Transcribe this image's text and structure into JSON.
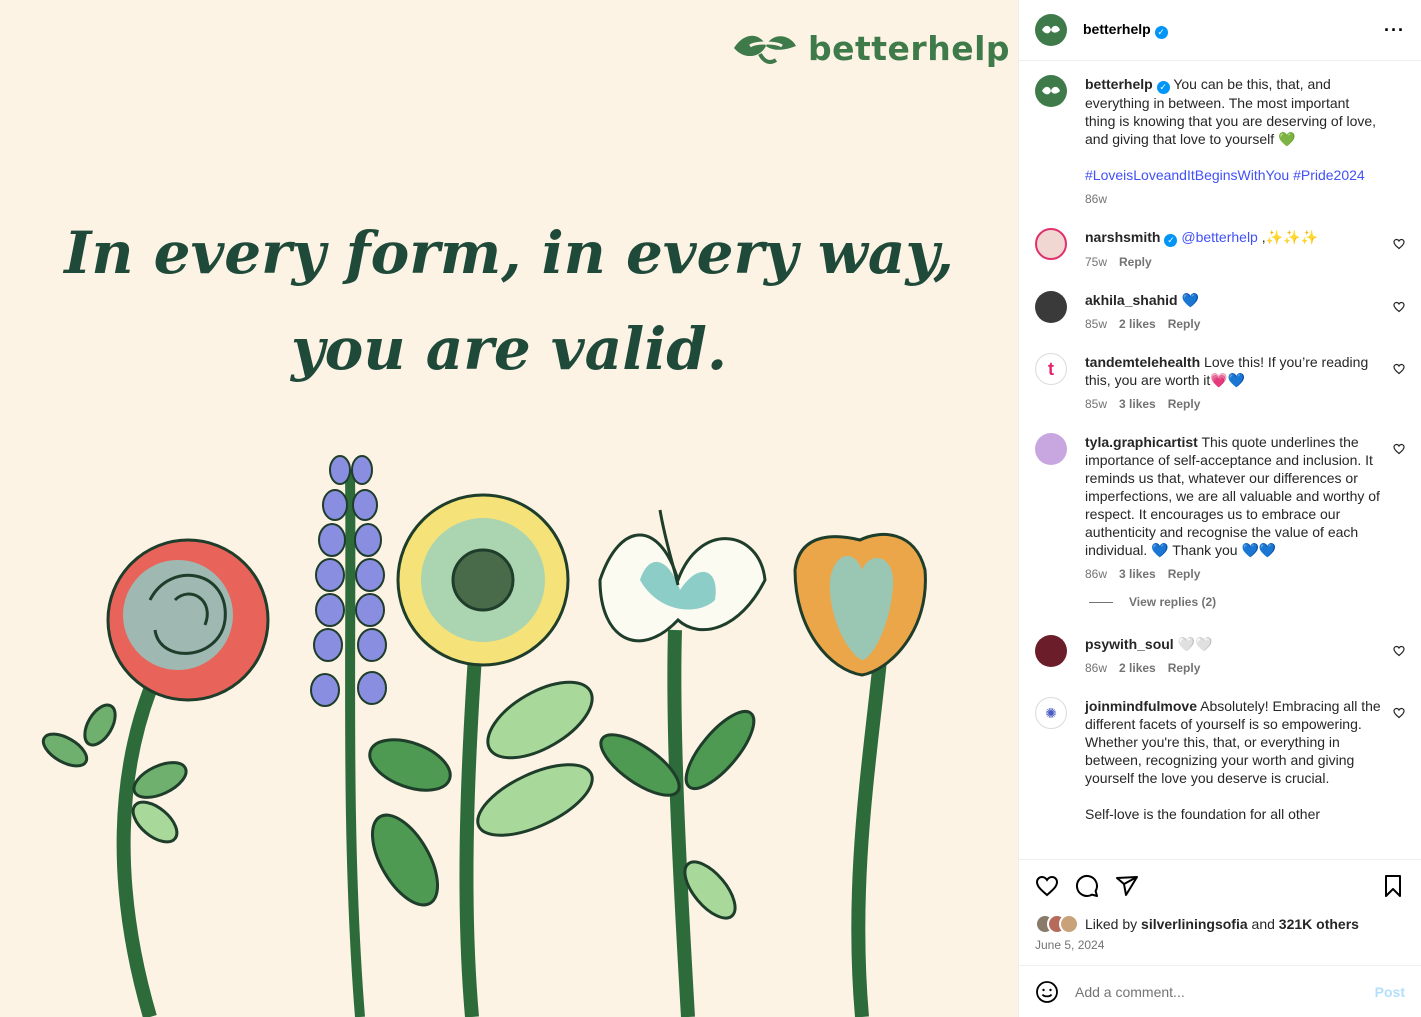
{
  "image": {
    "brand_name": "betterhelp",
    "quote_line1": "In every form, in every way,",
    "quote_line2": "you are valid."
  },
  "header": {
    "username": "betterhelp",
    "verified": true,
    "more_icon": "more-horizontal-icon"
  },
  "caption": {
    "username": "betterhelp",
    "text": "You can be this, that, and everything in between. The most important thing is knowing that you are deserving of love, and giving that love to yourself 💚",
    "hashtags": "#LoveisLoveandItBeginsWithYou #Pride2024",
    "time": "86w"
  },
  "comments": [
    {
      "username": "narshsmith",
      "verified": true,
      "mention": "@betterhelp",
      "text": " ,✨✨✨",
      "time": "75w",
      "likes": "",
      "reply": "Reply"
    },
    {
      "username": "akhila_shahid",
      "verified": false,
      "mention": "",
      "text": "💙",
      "time": "85w",
      "likes": "2 likes",
      "reply": "Reply"
    },
    {
      "username": "tandemtelehealth",
      "verified": false,
      "mention": "",
      "text": "Love this! If you’re reading this, you are worth it💗💙",
      "time": "85w",
      "likes": "3 likes",
      "reply": "Reply"
    },
    {
      "username": "tyla.graphicartist",
      "verified": false,
      "mention": "",
      "text": "This quote underlines the importance of self-acceptance and inclusion. It reminds us that, whatever our differences or imperfections, we are all valuable and worthy of respect. It encourages us to embrace our authenticity and recognise the value of each individual. 💙 Thank you 💙💙",
      "time": "86w",
      "likes": "3 likes",
      "reply": "Reply"
    },
    {
      "username": "psywith_soul",
      "verified": false,
      "mention": "",
      "text": "🤍🤍",
      "time": "86w",
      "likes": "2 likes",
      "reply": "Reply"
    },
    {
      "username": "joinmindfulmove",
      "verified": false,
      "mention": "",
      "text": "Absolutely! Embracing all the different facets of yourself is so empowering. Whether you're this, that, or everything in between, recognizing your worth and giving yourself the love you deserve is crucial.",
      "text2": "Self-love is the foundation for all other",
      "time": "",
      "likes": "",
      "reply": ""
    }
  ],
  "view_replies": "View replies (2)",
  "actions": {
    "liked_by_prefix": "Liked by",
    "liked_by_user": "silverliningsofia",
    "liked_by_and": "and",
    "liked_by_count": "321K others",
    "date": "June 5, 2024"
  },
  "add_comment": {
    "placeholder": "Add a comment...",
    "post_label": "Post"
  },
  "colors": {
    "brand_green": "#3f7a4a",
    "quote_green": "#1f4a3a",
    "background_cream": "#fcf3e4",
    "verified_blue": "#0095f6",
    "hashtag_blue": "#4150f7"
  }
}
